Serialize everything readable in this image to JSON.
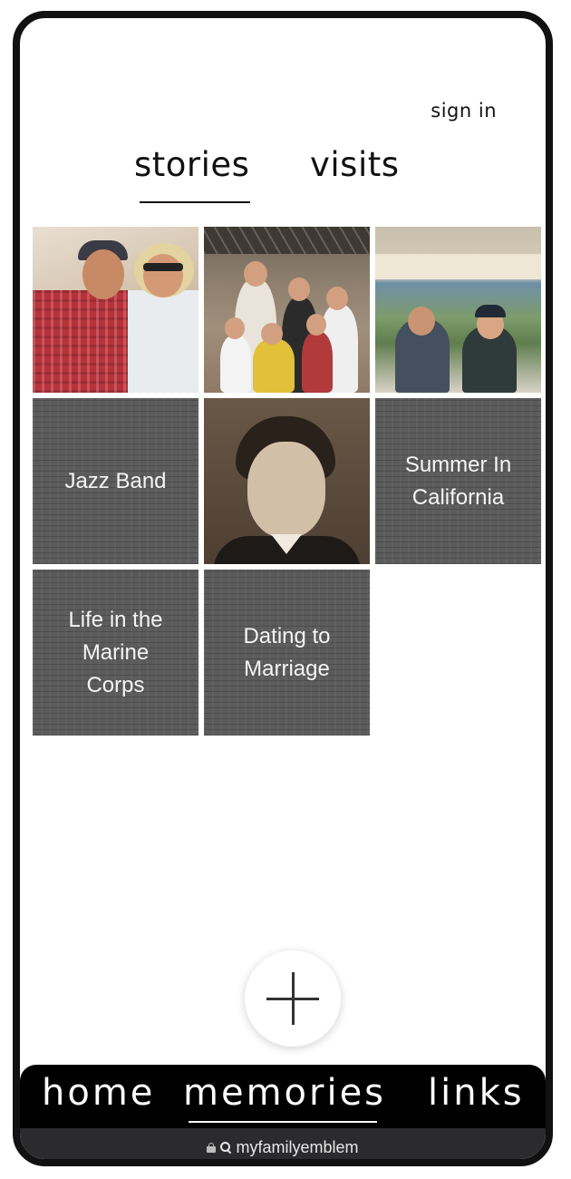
{
  "header": {
    "sign_in_label": "sign in"
  },
  "tabs": [
    {
      "label": "stories",
      "active": true
    },
    {
      "label": "visits",
      "active": false
    }
  ],
  "grid": {
    "tiles": [
      {
        "kind": "photo",
        "description_icon": "couple-photo"
      },
      {
        "kind": "photo",
        "description_icon": "family-photo"
      },
      {
        "kind": "photo",
        "description_icon": "couple-outdoors-photo"
      },
      {
        "kind": "text",
        "label": "Jazz Band"
      },
      {
        "kind": "photo",
        "description_icon": "portrait-photo"
      },
      {
        "kind": "text",
        "label": "Summer In\nCalifornia"
      },
      {
        "kind": "text",
        "label": "Life in the\nMarine\nCorps"
      },
      {
        "kind": "text",
        "label": "Dating to\nMarriage"
      }
    ]
  },
  "fab": {
    "icon": "plus-icon"
  },
  "bottom_nav": {
    "items": [
      {
        "label": "home",
        "active": false
      },
      {
        "label": "memories",
        "active": true
      },
      {
        "label": "links",
        "active": false
      }
    ]
  },
  "url_bar": {
    "url": "myfamilyemblem",
    "icons": [
      "lock-icon",
      "search-icon"
    ]
  },
  "colors": {
    "frame": "#111111",
    "nav_background": "#000000",
    "url_bar_background": "#2b2b2d",
    "text_tile_background": "#5b5b5b"
  }
}
